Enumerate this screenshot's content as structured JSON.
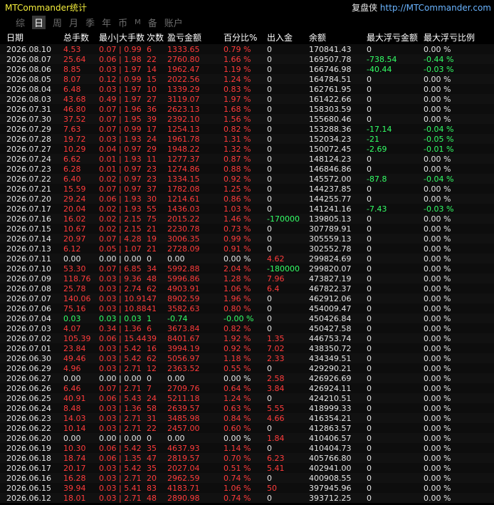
{
  "app": {
    "title": "MTCommander统计",
    "brand": "复盘侠",
    "url": "http://MTCommander.com"
  },
  "tabs": [
    {
      "label": "综",
      "active": false
    },
    {
      "label": "日",
      "active": true
    },
    {
      "label": "周",
      "active": false
    },
    {
      "label": "月",
      "active": false
    },
    {
      "label": "季",
      "active": false
    },
    {
      "label": "年",
      "active": false
    },
    {
      "label": "币",
      "active": false
    },
    {
      "label": "M",
      "active": false
    },
    {
      "label": "备",
      "active": false
    },
    {
      "label": "账户",
      "active": false
    }
  ],
  "columns": [
    "日期",
    "总手数",
    "最小|大手数",
    "次数",
    "盈亏金额",
    "百分比%",
    "出入金",
    "余额",
    "最大浮亏金额",
    "最大浮亏比例"
  ],
  "colors": {
    "red": "#ff3b3b",
    "green": "#33ff66",
    "white": "#e6e6e6"
  },
  "rows": [
    {
      "date": "2026.08.10",
      "lots": "4.53",
      "minmax": "0.07 | 0.99",
      "count": "6",
      "pnl": "1333.65",
      "pct": "0.79 %",
      "flow": "0",
      "balance": "170841.43",
      "maxdd": "0",
      "maxddpct": "0.00 %",
      "color": "red",
      "flowColor": "white",
      "ddColor": "white"
    },
    {
      "date": "2026.08.07",
      "lots": "25.64",
      "minmax": "0.06 | 1.98",
      "count": "22",
      "pnl": "2760.80",
      "pct": "1.66 %",
      "flow": "0",
      "balance": "169507.78",
      "maxdd": "-738.54",
      "maxddpct": "-0.44 %",
      "color": "red",
      "flowColor": "white",
      "ddColor": "green"
    },
    {
      "date": "2026.08.06",
      "lots": "8.85",
      "minmax": "0.03 | 1.97",
      "count": "14",
      "pnl": "1962.47",
      "pct": "1.19 %",
      "flow": "0",
      "balance": "166746.98",
      "maxdd": "-40.44",
      "maxddpct": "-0.03 %",
      "color": "red",
      "flowColor": "white",
      "ddColor": "green"
    },
    {
      "date": "2026.08.05",
      "lots": "8.07",
      "minmax": "0.12 | 0.99",
      "count": "15",
      "pnl": "2022.56",
      "pct": "1.24 %",
      "flow": "0",
      "balance": "164784.51",
      "maxdd": "0",
      "maxddpct": "0.00 %",
      "color": "red",
      "flowColor": "white",
      "ddColor": "white"
    },
    {
      "date": "2026.08.04",
      "lots": "6.48",
      "minmax": "0.03 | 1.97",
      "count": "10",
      "pnl": "1339.29",
      "pct": "0.83 %",
      "flow": "0",
      "balance": "162761.95",
      "maxdd": "0",
      "maxddpct": "0.00 %",
      "color": "red",
      "flowColor": "white",
      "ddColor": "white"
    },
    {
      "date": "2026.08.03",
      "lots": "43.68",
      "minmax": "0.49 | 1.97",
      "count": "27",
      "pnl": "3119.07",
      "pct": "1.97 %",
      "flow": "0",
      "balance": "161422.66",
      "maxdd": "0",
      "maxddpct": "0.00 %",
      "color": "red",
      "flowColor": "white",
      "ddColor": "white"
    },
    {
      "date": "2026.07.31",
      "lots": "46.80",
      "minmax": "0.07 | 1.96",
      "count": "36",
      "pnl": "2623.13",
      "pct": "1.68 %",
      "flow": "0",
      "balance": "158303.59",
      "maxdd": "0",
      "maxddpct": "0.00 %",
      "color": "red",
      "flowColor": "white",
      "ddColor": "white"
    },
    {
      "date": "2026.07.30",
      "lots": "37.52",
      "minmax": "0.07 | 1.95",
      "count": "39",
      "pnl": "2392.10",
      "pct": "1.56 %",
      "flow": "0",
      "balance": "155680.46",
      "maxdd": "0",
      "maxddpct": "0.00 %",
      "color": "red",
      "flowColor": "white",
      "ddColor": "white"
    },
    {
      "date": "2026.07.29",
      "lots": "7.63",
      "minmax": "0.07 | 0.99",
      "count": "17",
      "pnl": "1254.13",
      "pct": "0.82 %",
      "flow": "0",
      "balance": "153288.36",
      "maxdd": "-17.14",
      "maxddpct": "-0.04 %",
      "color": "red",
      "flowColor": "white",
      "ddColor": "green"
    },
    {
      "date": "2026.07.28",
      "lots": "19.72",
      "minmax": "0.03 | 1.93",
      "count": "24",
      "pnl": "1961.78",
      "pct": "1.31 %",
      "flow": "0",
      "balance": "152034.23",
      "maxdd": "-21",
      "maxddpct": "-0.05 %",
      "color": "red",
      "flowColor": "white",
      "ddColor": "green"
    },
    {
      "date": "2026.07.27",
      "lots": "10.29",
      "minmax": "0.04 | 0.97",
      "count": "29",
      "pnl": "1948.22",
      "pct": "1.32 %",
      "flow": "0",
      "balance": "150072.45",
      "maxdd": "-2.69",
      "maxddpct": "-0.01 %",
      "color": "red",
      "flowColor": "white",
      "ddColor": "green"
    },
    {
      "date": "2026.07.24",
      "lots": "6.62",
      "minmax": "0.01 | 1.93",
      "count": "11",
      "pnl": "1277.37",
      "pct": "0.87 %",
      "flow": "0",
      "balance": "148124.23",
      "maxdd": "0",
      "maxddpct": "0.00 %",
      "color": "red",
      "flowColor": "white",
      "ddColor": "white"
    },
    {
      "date": "2026.07.23",
      "lots": "6.28",
      "minmax": "0.01 | 0.97",
      "count": "23",
      "pnl": "1274.86",
      "pct": "0.88 %",
      "flow": "0",
      "balance": "146846.86",
      "maxdd": "0",
      "maxddpct": "0.00 %",
      "color": "red",
      "flowColor": "white",
      "ddColor": "white"
    },
    {
      "date": "2026.07.22",
      "lots": "6.40",
      "minmax": "0.02 | 0.97",
      "count": "23",
      "pnl": "1334.15",
      "pct": "0.92 %",
      "flow": "0",
      "balance": "145572.00",
      "maxdd": "-87.8",
      "maxddpct": "-0.04 %",
      "color": "red",
      "flowColor": "white",
      "ddColor": "green"
    },
    {
      "date": "2026.07.21",
      "lots": "15.59",
      "minmax": "0.07 | 0.97",
      "count": "37",
      "pnl": "1782.08",
      "pct": "1.25 %",
      "flow": "0",
      "balance": "144237.85",
      "maxdd": "0",
      "maxddpct": "0.00 %",
      "color": "red",
      "flowColor": "white",
      "ddColor": "white"
    },
    {
      "date": "2026.07.20",
      "lots": "29.24",
      "minmax": "0.06 | 1.93",
      "count": "30",
      "pnl": "1214.61",
      "pct": "0.86 %",
      "flow": "0",
      "balance": "144255.77",
      "maxdd": "0",
      "maxddpct": "0.00 %",
      "color": "red",
      "flowColor": "white",
      "ddColor": "white"
    },
    {
      "date": "2026.07.17",
      "lots": "20.04",
      "minmax": "0.02 | 1.93",
      "count": "55",
      "pnl": "1436.03",
      "pct": "1.03 %",
      "flow": "0",
      "balance": "141241.16",
      "maxdd": "-7.43",
      "maxddpct": "-0.03 %",
      "color": "red",
      "flowColor": "white",
      "ddColor": "green"
    },
    {
      "date": "2026.07.16",
      "lots": "16.02",
      "minmax": "0.02 | 2.15",
      "count": "75",
      "pnl": "2015.22",
      "pct": "1.46 %",
      "flow": "-170000",
      "balance": "139805.13",
      "maxdd": "0",
      "maxddpct": "0.00 %",
      "color": "red",
      "flowColor": "green",
      "ddColor": "white"
    },
    {
      "date": "2026.07.15",
      "lots": "10.67",
      "minmax": "0.02 | 2.15",
      "count": "21",
      "pnl": "2230.78",
      "pct": "0.73 %",
      "flow": "0",
      "balance": "307789.91",
      "maxdd": "0",
      "maxddpct": "0.00 %",
      "color": "red",
      "flowColor": "white",
      "ddColor": "white"
    },
    {
      "date": "2026.07.14",
      "lots": "20.97",
      "minmax": "0.07 | 4.28",
      "count": "19",
      "pnl": "3006.35",
      "pct": "0.99 %",
      "flow": "0",
      "balance": "305559.13",
      "maxdd": "0",
      "maxddpct": "0.00 %",
      "color": "red",
      "flowColor": "white",
      "ddColor": "white"
    },
    {
      "date": "2026.07.13",
      "lots": "6.12",
      "minmax": "0.05 | 1.07",
      "count": "21",
      "pnl": "2728.09",
      "pct": "0.91 %",
      "flow": "0",
      "balance": "302552.78",
      "maxdd": "0",
      "maxddpct": "0.00 %",
      "color": "red",
      "flowColor": "white",
      "ddColor": "white"
    },
    {
      "date": "2026.07.11",
      "lots": "0.00",
      "minmax": "0.00 | 0.00",
      "count": "0",
      "pnl": "0.00",
      "pct": "0.00 %",
      "flow": "4.62",
      "balance": "299824.69",
      "maxdd": "0",
      "maxddpct": "0.00 %",
      "color": "white",
      "flowColor": "red",
      "ddColor": "white"
    },
    {
      "date": "2026.07.10",
      "lots": "53.30",
      "minmax": "0.07 | 6.85",
      "count": "34",
      "pnl": "5992.88",
      "pct": "2.04 %",
      "flow": "-180000",
      "balance": "299820.07",
      "maxdd": "0",
      "maxddpct": "0.00 %",
      "color": "red",
      "flowColor": "green",
      "ddColor": "white"
    },
    {
      "date": "2026.07.09",
      "lots": "118.76",
      "minmax": "0.03 | 9.36",
      "count": "48",
      "pnl": "5996.86",
      "pct": "1.28 %",
      "flow": "7.96",
      "balance": "473827.19",
      "maxdd": "0",
      "maxddpct": "0.00 %",
      "color": "red",
      "flowColor": "red",
      "ddColor": "white"
    },
    {
      "date": "2026.07.08",
      "lots": "25.78",
      "minmax": "0.03 | 2.74",
      "count": "62",
      "pnl": "4903.91",
      "pct": "1.06 %",
      "flow": "6.4",
      "balance": "467822.37",
      "maxdd": "0",
      "maxddpct": "0.00 %",
      "color": "red",
      "flowColor": "red",
      "ddColor": "white"
    },
    {
      "date": "2026.07.07",
      "lots": "140.06",
      "minmax": "0.03 | 10.91",
      "count": "47",
      "pnl": "8902.59",
      "pct": "1.96 %",
      "flow": "0",
      "balance": "462912.06",
      "maxdd": "0",
      "maxddpct": "0.00 %",
      "color": "red",
      "flowColor": "white",
      "ddColor": "white"
    },
    {
      "date": "2026.07.06",
      "lots": "75.16",
      "minmax": "0.03 | 10.88",
      "count": "41",
      "pnl": "3582.63",
      "pct": "0.80 %",
      "flow": "0",
      "balance": "454009.47",
      "maxdd": "0",
      "maxddpct": "0.00 %",
      "color": "red",
      "flowColor": "white",
      "ddColor": "white"
    },
    {
      "date": "2026.07.04",
      "lots": "0.03",
      "minmax": "0.03 | 0.03",
      "count": "1",
      "pnl": "-0.74",
      "pct": "-0.00 %",
      "flow": "0",
      "balance": "450426.84",
      "maxdd": "0",
      "maxddpct": "0.00 %",
      "color": "green",
      "flowColor": "white",
      "ddColor": "white"
    },
    {
      "date": "2026.07.03",
      "lots": "4.07",
      "minmax": "0.34 | 1.36",
      "count": "6",
      "pnl": "3673.84",
      "pct": "0.82 %",
      "flow": "0",
      "balance": "450427.58",
      "maxdd": "0",
      "maxddpct": "0.00 %",
      "color": "red",
      "flowColor": "white",
      "ddColor": "white"
    },
    {
      "date": "2026.07.02",
      "lots": "105.39",
      "minmax": "0.06 | 15.44",
      "count": "39",
      "pnl": "8401.67",
      "pct": "1.92 %",
      "flow": "1.35",
      "balance": "446753.74",
      "maxdd": "0",
      "maxddpct": "0.00 %",
      "color": "red",
      "flowColor": "red",
      "ddColor": "white"
    },
    {
      "date": "2026.07.01",
      "lots": "23.84",
      "minmax": "0.03 | 5.42",
      "count": "16",
      "pnl": "3994.19",
      "pct": "0.92 %",
      "flow": "7.02",
      "balance": "438350.72",
      "maxdd": "0",
      "maxddpct": "0.00 %",
      "color": "red",
      "flowColor": "red",
      "ddColor": "white"
    },
    {
      "date": "2026.06.30",
      "lots": "49.46",
      "minmax": "0.03 | 5.42",
      "count": "62",
      "pnl": "5056.97",
      "pct": "1.18 %",
      "flow": "2.33",
      "balance": "434349.51",
      "maxdd": "0",
      "maxddpct": "0.00 %",
      "color": "red",
      "flowColor": "red",
      "ddColor": "white"
    },
    {
      "date": "2026.06.29",
      "lots": "4.96",
      "minmax": "0.03 | 2.71",
      "count": "12",
      "pnl": "2363.52",
      "pct": "0.55 %",
      "flow": "0",
      "balance": "429290.21",
      "maxdd": "0",
      "maxddpct": "0.00 %",
      "color": "red",
      "flowColor": "white",
      "ddColor": "white"
    },
    {
      "date": "2026.06.27",
      "lots": "0.00",
      "minmax": "0.00 | 0.00",
      "count": "0",
      "pnl": "0.00",
      "pct": "0.00 %",
      "flow": "2.58",
      "balance": "426926.69",
      "maxdd": "0",
      "maxddpct": "0.00 %",
      "color": "white",
      "flowColor": "red",
      "ddColor": "white"
    },
    {
      "date": "2026.06.26",
      "lots": "6.46",
      "minmax": "0.07 | 2.71",
      "count": "7",
      "pnl": "2709.76",
      "pct": "0.64 %",
      "flow": "3.84",
      "balance": "426924.11",
      "maxdd": "0",
      "maxddpct": "0.00 %",
      "color": "red",
      "flowColor": "red",
      "ddColor": "white"
    },
    {
      "date": "2026.06.25",
      "lots": "40.91",
      "minmax": "0.06 | 5.43",
      "count": "24",
      "pnl": "5211.18",
      "pct": "1.24 %",
      "flow": "0",
      "balance": "424210.51",
      "maxdd": "0",
      "maxddpct": "0.00 %",
      "color": "red",
      "flowColor": "white",
      "ddColor": "white"
    },
    {
      "date": "2026.06.24",
      "lots": "8.48",
      "minmax": "0.03 | 1.36",
      "count": "58",
      "pnl": "2639.57",
      "pct": "0.63 %",
      "flow": "5.55",
      "balance": "418999.33",
      "maxdd": "0",
      "maxddpct": "0.00 %",
      "color": "red",
      "flowColor": "red",
      "ddColor": "white"
    },
    {
      "date": "2026.06.23",
      "lots": "14.03",
      "minmax": "0.03 | 2.71",
      "count": "31",
      "pnl": "3485.98",
      "pct": "0.84 %",
      "flow": "4.66",
      "balance": "416354.21",
      "maxdd": "0",
      "maxddpct": "0.00 %",
      "color": "red",
      "flowColor": "red",
      "ddColor": "white"
    },
    {
      "date": "2026.06.22",
      "lots": "10.14",
      "minmax": "0.03 | 2.71",
      "count": "22",
      "pnl": "2457.00",
      "pct": "0.60 %",
      "flow": "0",
      "balance": "412863.57",
      "maxdd": "0",
      "maxddpct": "0.00 %",
      "color": "red",
      "flowColor": "white",
      "ddColor": "white"
    },
    {
      "date": "2026.06.20",
      "lots": "0.00",
      "minmax": "0.00 | 0.00",
      "count": "0",
      "pnl": "0.00",
      "pct": "0.00 %",
      "flow": "1.84",
      "balance": "410406.57",
      "maxdd": "0",
      "maxddpct": "0.00 %",
      "color": "white",
      "flowColor": "red",
      "ddColor": "white"
    },
    {
      "date": "2026.06.19",
      "lots": "10.30",
      "minmax": "0.06 | 5.42",
      "count": "35",
      "pnl": "4637.93",
      "pct": "1.14 %",
      "flow": "0",
      "balance": "410404.73",
      "maxdd": "0",
      "maxddpct": "0.00 %",
      "color": "red",
      "flowColor": "white",
      "ddColor": "white"
    },
    {
      "date": "2026.06.18",
      "lots": "18.74",
      "minmax": "0.06 | 1.35",
      "count": "47",
      "pnl": "2819.57",
      "pct": "0.70 %",
      "flow": "6.23",
      "balance": "405766.80",
      "maxdd": "0",
      "maxddpct": "0.00 %",
      "color": "red",
      "flowColor": "red",
      "ddColor": "white"
    },
    {
      "date": "2026.06.17",
      "lots": "20.17",
      "minmax": "0.03 | 5.42",
      "count": "35",
      "pnl": "2027.04",
      "pct": "0.51 %",
      "flow": "5.41",
      "balance": "402941.00",
      "maxdd": "0",
      "maxddpct": "0.00 %",
      "color": "red",
      "flowColor": "red",
      "ddColor": "white"
    },
    {
      "date": "2026.06.16",
      "lots": "16.28",
      "minmax": "0.03 | 2.71",
      "count": "20",
      "pnl": "2962.59",
      "pct": "0.74 %",
      "flow": "0",
      "balance": "400908.55",
      "maxdd": "0",
      "maxddpct": "0.00 %",
      "color": "red",
      "flowColor": "white",
      "ddColor": "white"
    },
    {
      "date": "2026.06.15",
      "lots": "39.94",
      "minmax": "0.03 | 5.41",
      "count": "83",
      "pnl": "4183.71",
      "pct": "1.06 %",
      "flow": "50",
      "balance": "397945.96",
      "maxdd": "0",
      "maxddpct": "0.00 %",
      "color": "red",
      "flowColor": "red",
      "ddColor": "white"
    },
    {
      "date": "2026.06.12",
      "lots": "18.01",
      "minmax": "0.03 | 2.71",
      "count": "48",
      "pnl": "2890.98",
      "pct": "0.74 %",
      "flow": "0",
      "balance": "393712.25",
      "maxdd": "0",
      "maxddpct": "0.00 %",
      "color": "red",
      "flowColor": "white",
      "ddColor": "white"
    }
  ]
}
